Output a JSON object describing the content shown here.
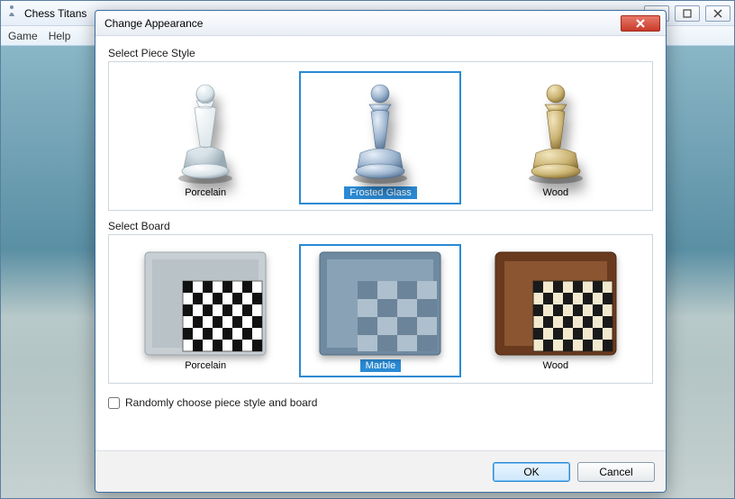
{
  "app": {
    "title": "Chess Titans",
    "menu": {
      "game": "Game",
      "help": "Help"
    }
  },
  "dialog": {
    "title": "Change Appearance",
    "piece_section_label": "Select Piece Style",
    "piece_options": {
      "porcelain": "Porcelain",
      "frosted_glass": "Frosted Glass",
      "wood": "Wood"
    },
    "board_section_label": "Select Board",
    "board_options": {
      "porcelain": "Porcelain",
      "marble": "Marble",
      "wood": "Wood"
    },
    "checkbox_label": "Randomly choose piece style and board",
    "ok_label": "OK",
    "cancel_label": "Cancel",
    "selected_piece": "frosted_glass",
    "selected_board": "marble"
  },
  "colors": {
    "selection": "#2a8ad4",
    "piece_porcelain_light": "#fafcfd",
    "piece_porcelain_dark": "#a9b8c1",
    "piece_glass_light": "#cddceb",
    "piece_glass_dark": "#5e7fa2",
    "piece_wood_light": "#e3cf96",
    "piece_wood_dark": "#8f7a3e",
    "board_porcelain_frame": "#c7cfd3",
    "board_marble_frame": "#6f8aa0",
    "board_wood_frame": "#6a3a1f"
  }
}
